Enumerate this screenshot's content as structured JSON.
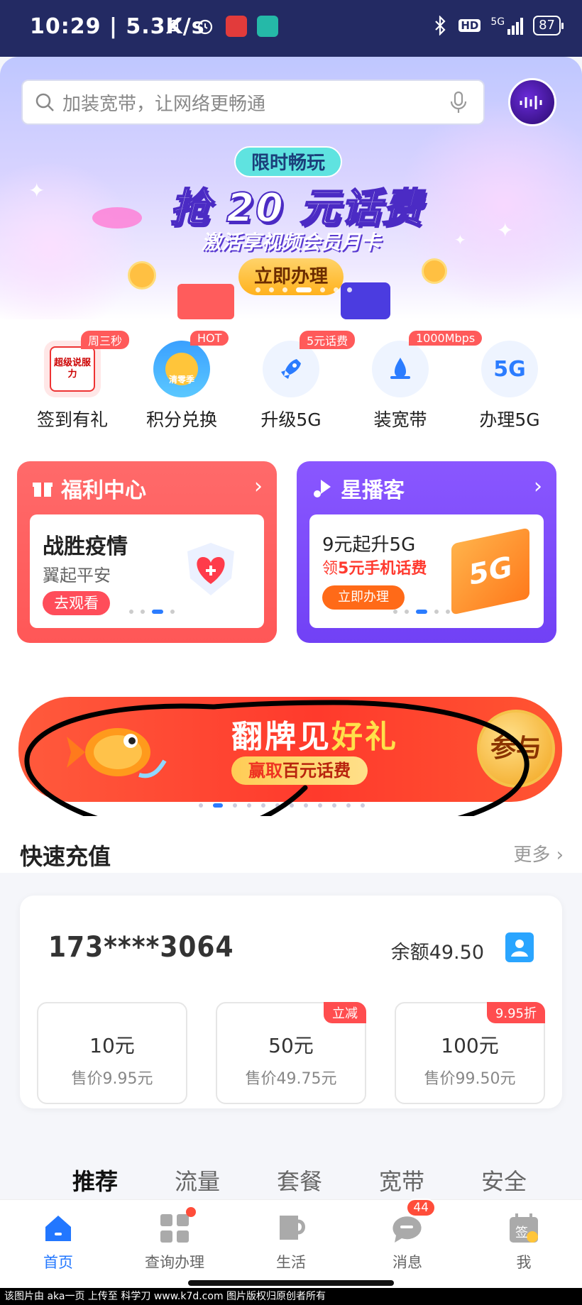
{
  "status_bar": {
    "time": "10:29",
    "speed": "5.3K/s",
    "network": "5G",
    "battery": "87",
    "hd": "HD"
  },
  "search": {
    "placeholder": "加装宽带，让网络更畅通"
  },
  "hero": {
    "tag": "限时畅玩",
    "title": "抢 20 元话费",
    "subtitle": "激活享视频会员月卡",
    "button": "立即办理"
  },
  "quick": [
    {
      "label": "签到有礼",
      "badge": "周三秒",
      "icon": "gift-card-icon"
    },
    {
      "label": "积分兑换",
      "badge": "HOT",
      "icon": "coin-icon"
    },
    {
      "label": "升级5G",
      "badge": "5元话费",
      "icon": "rocket-icon"
    },
    {
      "label": "装宽带",
      "badge": "1000Mbps",
      "icon": "broadband-icon"
    },
    {
      "label": "办理5G",
      "badge": "",
      "icon": "5g-icon"
    }
  ],
  "quick_icon_text": {
    "checkin": "超级说服力",
    "points": "清零季",
    "fiveg": "5G"
  },
  "welfare": {
    "title": "福利中心",
    "heading": "战胜疫情",
    "sub": "翼起平安",
    "button": "去观看"
  },
  "star": {
    "title": "星播客",
    "heading": "9元起升5G",
    "sub_prefix": "领",
    "sub": "5元手机话费",
    "button": "立即办理"
  },
  "promo": {
    "title_a": "翻牌见",
    "title_b": "好礼",
    "sub_a": "赢取",
    "sub_b": "百元话费",
    "join": "参与"
  },
  "recharge": {
    "title": "快速充值",
    "more": "更多",
    "phone": "173****3064",
    "balance": "余额49.50",
    "options": [
      {
        "value": "10元",
        "price": "售价9.95元",
        "badge": ""
      },
      {
        "value": "50元",
        "price": "售价49.75元",
        "badge": "立减"
      },
      {
        "value": "100元",
        "price": "售价99.50元",
        "badge": "9.95折"
      }
    ]
  },
  "tabs": [
    "推荐",
    "流量",
    "套餐",
    "宽带",
    "安全"
  ],
  "bottom_nav": [
    {
      "label": "首页",
      "icon": "home-icon",
      "active": true
    },
    {
      "label": "查询办理",
      "icon": "grid-icon"
    },
    {
      "label": "生活",
      "icon": "cup-icon"
    },
    {
      "label": "消息",
      "icon": "message-icon",
      "badge": "44"
    },
    {
      "label": "我",
      "icon": "calendar-icon"
    }
  ],
  "me_icon_text": "签",
  "footer": "该图片由 aka一页 上传至 科学刀 www.k7d.com 图片版权归原创者所有",
  "colors": {
    "accent": "#2277ff",
    "red": "#ff5757",
    "purple": "#7141f5",
    "statusbar": "#232a63"
  }
}
